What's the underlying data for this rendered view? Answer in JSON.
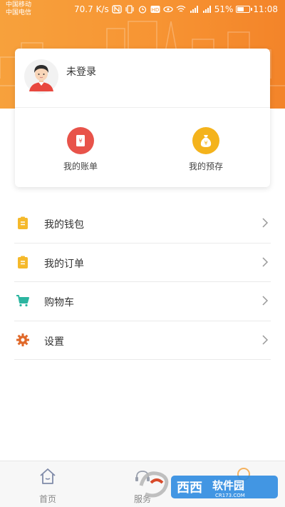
{
  "status_bar": {
    "carrier_1": "中国移动",
    "carrier_2": "中国电信",
    "speed": "70.7 K/s",
    "signal_1": "4G",
    "signal_2": "2G",
    "battery": "51%",
    "time": "11:08"
  },
  "profile": {
    "username": "未登录",
    "avatar_icon": "user-avatar-icon"
  },
  "quick_actions": [
    {
      "label": "我的账单",
      "icon": "bill-icon",
      "color": "#e8534a"
    },
    {
      "label": "我的预存",
      "icon": "money-bag-icon",
      "color": "#f4b31c"
    }
  ],
  "menu": [
    {
      "label": "我的钱包",
      "icon": "clipboard-icon",
      "color": "#f5b92b"
    },
    {
      "label": "我的订单",
      "icon": "clipboard-icon",
      "color": "#f5b92b"
    },
    {
      "label": "购物车",
      "icon": "cart-icon",
      "color": "#2bb5a0"
    },
    {
      "label": "设置",
      "icon": "gear-icon",
      "color": "#e0692a"
    }
  ],
  "bottom_nav": [
    {
      "label": "首页",
      "icon": "home-icon"
    },
    {
      "label": "服务",
      "icon": "service-icon"
    }
  ],
  "watermark": {
    "text": "西西软件园",
    "sub": "CR173.COM"
  },
  "colors": {
    "header_orange": "#f79433",
    "accent": "#e8534a"
  }
}
